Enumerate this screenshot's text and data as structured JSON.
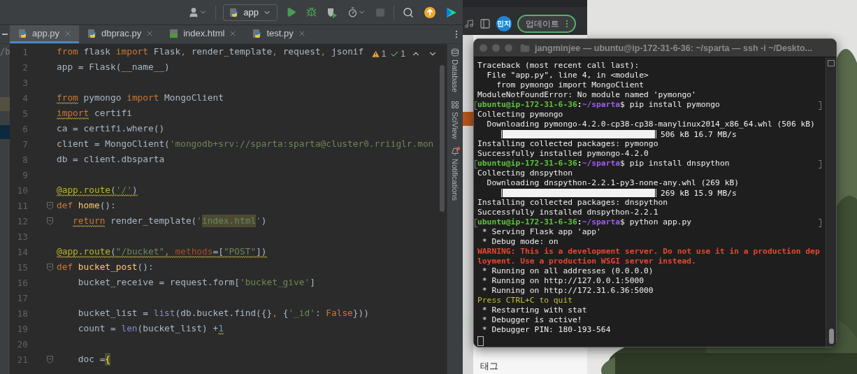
{
  "ide": {
    "toolbar": {
      "run_config": "app",
      "stop_disabled": true
    },
    "tabs": [
      {
        "label": "app.py",
        "kind": "python",
        "selected": true
      },
      {
        "label": "dbprac.py",
        "kind": "python",
        "selected": false
      },
      {
        "label": "index.html",
        "kind": "html",
        "selected": false
      },
      {
        "label": "test.py",
        "kind": "python",
        "selected": false
      }
    ],
    "project_edge": "/b",
    "inspections": {
      "warnings": "1",
      "typos": "1"
    },
    "lines": [
      {
        "number": "1",
        "kind": "top",
        "tokens": [
          {
            "text": "from",
            "kind": "kw"
          },
          {
            "text": " flask ",
            "kind": "plain"
          },
          {
            "text": "import",
            "kind": "kw"
          },
          {
            "text": " Flask",
            "kind": "plain"
          },
          {
            "text": ",",
            "kind": "kw"
          },
          {
            "text": " render_template",
            "kind": "plain"
          },
          {
            "text": ",",
            "kind": "kw"
          },
          {
            "text": " request",
            "kind": "plain"
          },
          {
            "text": ",",
            "kind": "kw"
          },
          {
            "text": " jsonif",
            "kind": "plain"
          }
        ]
      },
      {
        "number": "2",
        "kind": "top",
        "tokens": [
          {
            "text": "app = Flask(__name__)",
            "kind": "plain"
          }
        ]
      },
      {
        "number": "3"
      },
      {
        "number": "4",
        "kind": "top",
        "tokens": [
          {
            "text": "from",
            "kind": "kw",
            "squiggle": true
          },
          {
            "text": " pymongo ",
            "kind": "plain"
          },
          {
            "text": "import",
            "kind": "kw"
          },
          {
            "text": " MongoClient",
            "kind": "plain"
          }
        ]
      },
      {
        "number": "5",
        "kind": "top",
        "tokens": [
          {
            "text": "import",
            "kind": "kw",
            "squiggle": true
          },
          {
            "text": " certifi",
            "kind": "plain"
          }
        ]
      },
      {
        "number": "6",
        "kind": "top",
        "tokens": [
          {
            "text": "ca = certifi.where()",
            "kind": "plain"
          }
        ]
      },
      {
        "number": "7",
        "kind": "top",
        "tokens": [
          {
            "text": "client = MongoClient(",
            "kind": "plain"
          },
          {
            "text": "'mongodb+srv://sparta:sparta@cluster0.rriiglr.mon",
            "kind": "str"
          }
        ]
      },
      {
        "number": "8",
        "kind": "top",
        "tokens": [
          {
            "text": "db = client.dbsparta",
            "kind": "plain"
          }
        ]
      },
      {
        "number": "9"
      },
      {
        "number": "10",
        "kind": "top",
        "tokens": [
          {
            "text": "@app.route",
            "kind": "deco",
            "squiggle": true
          },
          {
            "text": "(",
            "kind": "plain",
            "squiggle": true
          },
          {
            "text": "'/'",
            "kind": "str",
            "squiggle": true
          },
          {
            "text": ")",
            "kind": "plain",
            "squiggle": true
          }
        ]
      },
      {
        "number": "11",
        "kind": "top",
        "fold": true,
        "tokens": [
          {
            "text": "def",
            "kind": "kw"
          },
          {
            "text": " home",
            "kind": "fn"
          },
          {
            "text": "():",
            "kind": "plain"
          }
        ]
      },
      {
        "number": "12",
        "kind": "shallow",
        "fold": true,
        "tokens": [
          {
            "text": "return",
            "kind": "kw",
            "squiggle": true
          },
          {
            "text": " render_template(",
            "kind": "plain"
          },
          {
            "text": "'",
            "kind": "str"
          },
          {
            "text": "index.html",
            "kind": "str",
            "highlight": true
          },
          {
            "text": "'",
            "kind": "str"
          },
          {
            "text": ")",
            "kind": "plain"
          }
        ]
      },
      {
        "number": "13"
      },
      {
        "number": "14",
        "kind": "top",
        "tokens": [
          {
            "text": "@app.route",
            "kind": "deco",
            "squiggle": true
          },
          {
            "text": "(",
            "kind": "plain",
            "squiggle": true
          },
          {
            "text": "\"/bucket\"",
            "kind": "str",
            "squiggle": true
          },
          {
            "text": ", ",
            "kind": "kw",
            "squiggle": true
          },
          {
            "text": "methods",
            "kind": "kwarg",
            "squiggle": true
          },
          {
            "text": "=[",
            "kind": "plain",
            "squiggle": true
          },
          {
            "text": "\"POST\"",
            "kind": "str",
            "squiggle": true
          },
          {
            "text": "])",
            "kind": "plain",
            "squiggle": true
          }
        ]
      },
      {
        "number": "15",
        "kind": "top",
        "fold": true,
        "tokens": [
          {
            "text": "def",
            "kind": "kw"
          },
          {
            "text": " bucket_post",
            "kind": "fn"
          },
          {
            "text": "():",
            "kind": "plain"
          }
        ]
      },
      {
        "number": "16",
        "kind": "body",
        "tokens": [
          {
            "text": "bucket_receive = request.form[",
            "kind": "plain"
          },
          {
            "text": "'bucket_give'",
            "kind": "str"
          },
          {
            "text": "]",
            "kind": "plain"
          }
        ]
      },
      {
        "number": "17"
      },
      {
        "number": "18",
        "kind": "body",
        "tokens": [
          {
            "text": "bucket_list = ",
            "kind": "plain"
          },
          {
            "text": "list",
            "kind": "builtin"
          },
          {
            "text": "(db.bucket.find({}",
            "kind": "plain"
          },
          {
            "text": ",",
            "kind": "kw"
          },
          {
            "text": " {",
            "kind": "plain"
          },
          {
            "text": "'_id'",
            "kind": "str"
          },
          {
            "text": ": ",
            "kind": "plain"
          },
          {
            "text": "False",
            "kind": "kw"
          },
          {
            "text": "}))",
            "kind": "plain"
          }
        ]
      },
      {
        "number": "19",
        "kind": "body",
        "tokens": [
          {
            "text": "count = ",
            "kind": "plain"
          },
          {
            "text": "len",
            "kind": "builtin"
          },
          {
            "text": "(bucket_list) +",
            "kind": "plain"
          },
          {
            "text": "1",
            "kind": "num",
            "squiggle": true
          }
        ]
      },
      {
        "number": "20"
      },
      {
        "number": "21",
        "kind": "body",
        "fold": true,
        "tokens": [
          {
            "text": "doc =",
            "kind": "plain"
          },
          {
            "text": "{",
            "kind": "brace",
            "highlight": true
          }
        ]
      }
    ],
    "tool_windows": [
      {
        "label": "Database",
        "badge": false
      },
      {
        "label": "SciView",
        "badge": false
      },
      {
        "label": "Notifications",
        "badge": true
      }
    ]
  },
  "browser": {
    "avatar": "민지",
    "update_button": "업데이트",
    "page_text": "태그"
  },
  "terminal": {
    "title": "jangminjee — ubuntu@ip-172-31-6-36: ~/sparta — ssh -i ~/Deskto...",
    "lines": [
      {
        "kind": "plain",
        "text": "Traceback (most recent call last):"
      },
      {
        "kind": "plain",
        "text": "  File \"app.py\", line 4, in <module>"
      },
      {
        "kind": "plain",
        "text": "    from pymongo import MongoClient"
      },
      {
        "kind": "plain",
        "text": "ModuleNotFoundError: No module named 'pymongo'"
      },
      {
        "kind": "prompt",
        "user": "ubuntu@ip-172-31-6-36",
        "sep": ":",
        "path": "~/sparta",
        "command": "$ pip install pymongo"
      },
      {
        "kind": "plain",
        "text": "Collecting pymongo"
      },
      {
        "kind": "plain",
        "text": "  Downloading pymongo-4.2.0-cp38-cp38-manylinux2014_x86_64.whl (506 kB)"
      },
      {
        "kind": "progress",
        "level": 1,
        "text": "506 kB 16.7 MB/s"
      },
      {
        "kind": "plain",
        "text": "Installing collected packages: pymongo"
      },
      {
        "kind": "plain",
        "text": "Successfully installed pymongo-4.2.0"
      },
      {
        "kind": "prompt",
        "user": "ubuntu@ip-172-31-6-36",
        "sep": ":",
        "path": "~/sparta",
        "command": "$ pip install dnspython"
      },
      {
        "kind": "plain",
        "text": "Collecting dnspython"
      },
      {
        "kind": "plain",
        "text": "  Downloading dnspython-2.2.1-py3-none-any.whl (269 kB)"
      },
      {
        "kind": "progress",
        "level": 1,
        "text": "269 kB 15.9 MB/s"
      },
      {
        "kind": "plain",
        "text": "Installing collected packages: dnspython"
      },
      {
        "kind": "plain",
        "text": "Successfully installed dnspython-2.2.1"
      },
      {
        "kind": "prompt",
        "user": "ubuntu@ip-172-31-6-36",
        "sep": ":",
        "path": "~/sparta",
        "command": "$ python app.py"
      },
      {
        "kind": "plain",
        "text": " * Serving Flask app 'app'"
      },
      {
        "kind": "plain",
        "text": " * Debug mode: on"
      },
      {
        "kind": "warning",
        "text": "WARNING: This is a development server. Do not use it in a production dep"
      },
      {
        "kind": "warning",
        "text": "loyment. Use a production WSGI server instead."
      },
      {
        "kind": "plain",
        "text": " * Running on all addresses (0.0.0.0)"
      },
      {
        "kind": "plain",
        "text": " * Running on http://127.0.0.1:5000"
      },
      {
        "kind": "plain",
        "text": " * Running on http://172.31.6.36:5000"
      },
      {
        "kind": "notice",
        "text": "Press CTRL+C to quit"
      },
      {
        "kind": "plain",
        "text": " * Restarting with stat"
      },
      {
        "kind": "plain",
        "text": " * Debugger is active!"
      },
      {
        "kind": "plain",
        "text": " * Debugger PIN: 180-193-564"
      },
      {
        "kind": "cursor"
      }
    ]
  }
}
